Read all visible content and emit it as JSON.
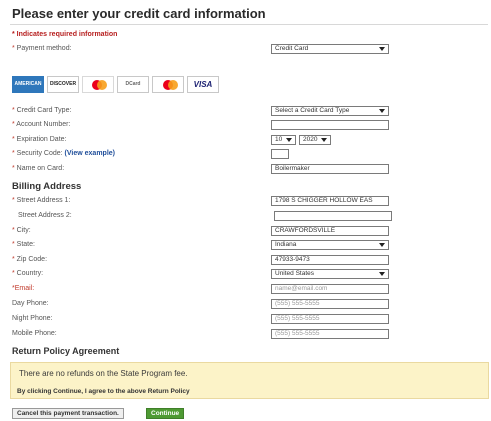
{
  "page": {
    "title": "Please enter your credit card information",
    "required_note": "* Indicates required information"
  },
  "payment": {
    "method_label": "Payment method:",
    "method_value": "Credit Card",
    "card_logos": [
      "AMERICAN EXPRESS",
      "DISCOVER",
      "Mastercard",
      "DCard",
      "Mastercard",
      "VISA"
    ],
    "card_type_label": "Credit Card Type:",
    "card_type_value": "Select a Credit Card Type",
    "account_label": "Account Number:",
    "account_value": "",
    "expiration_label": "Expiration Date:",
    "exp_month": "10",
    "exp_year": "2020",
    "security_label": "Security Code:",
    "security_link": "(View example)",
    "security_value": "",
    "name_label": "Name on Card:",
    "name_value": "Boilermaker"
  },
  "billing": {
    "heading": "Billing Address",
    "street1_label": "Street Address 1:",
    "street1_value": "1798 S CHIGGER HOLLOW EAS",
    "street2_label": "Street Address 2:",
    "street2_value": "",
    "city_label": "City:",
    "city_value": "CRAWFORDSVILLE",
    "state_label": "State:",
    "state_value": "Indiana",
    "zip_label": "Zip Code:",
    "zip_value": "47933-9473",
    "country_label": "Country:",
    "country_value": "United States",
    "email_label": "*Email:",
    "email_placeholder": "name@email.com",
    "day_phone_label": "Day Phone:",
    "day_phone_placeholder": "(555) 555-5555",
    "night_phone_label": "Night Phone:",
    "night_phone_placeholder": "(555) 555-5555",
    "mobile_phone_label": "Mobile Phone:",
    "mobile_phone_placeholder": "(555) 555-5555"
  },
  "policy": {
    "heading": "Return Policy Agreement",
    "notice": "There are no refunds on the State Program fee.",
    "agreement": "By clicking Continue, I agree to the above Return Policy"
  },
  "actions": {
    "cancel": "Cancel this payment transaction.",
    "continue": "Continue"
  },
  "colors": {
    "required": "#c0392b",
    "notice_bg": "#fcf3c8",
    "continue_bg": "#4e9a33",
    "link": "#1f4e9a"
  }
}
